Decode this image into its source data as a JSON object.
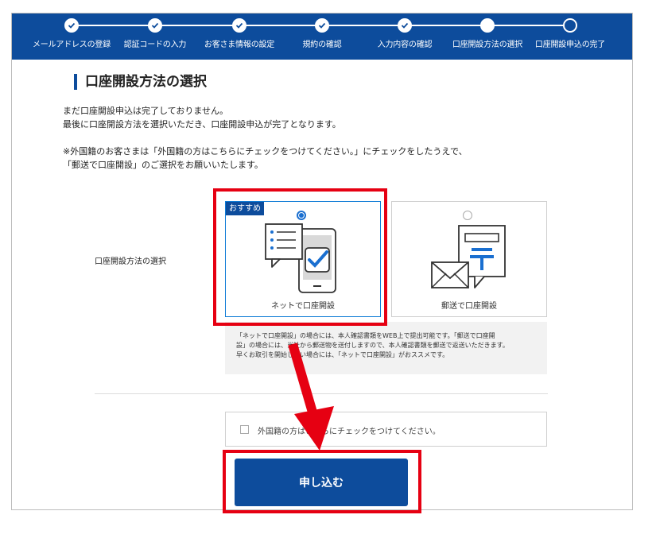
{
  "steps": [
    {
      "label": "メールアドレスの登録",
      "state": "done"
    },
    {
      "label": "認証コードの入力",
      "state": "done"
    },
    {
      "label": "お客さま情報の設定",
      "state": "done"
    },
    {
      "label": "規約の確認",
      "state": "done"
    },
    {
      "label": "入力内容の確認",
      "state": "done"
    },
    {
      "label": "口座開設方法の選択",
      "state": "current"
    },
    {
      "label": "口座開設申込の完了",
      "state": "todo"
    }
  ],
  "page": {
    "title": "口座開設方法の選択",
    "intro_line1": "まだ口座開設申込は完了しておりません。",
    "intro_line2": "最後に口座開設方法を選択いただき、口座開設申込が完了となります。",
    "foreign_line1": "※外国籍のお客さまは「外国籍の方はこちらにチェックをつけてください。」にチェックをしたうえで、",
    "foreign_line2": "「郵送で口座開設」のご選択をお願いいたします。"
  },
  "method": {
    "row_label": "口座開設方法の選択",
    "recommend_badge": "おすすめ",
    "options": [
      {
        "label": "ネットで口座開設",
        "selected": true,
        "icon": "smartphone-check-icon"
      },
      {
        "label": "郵送で口座開設",
        "selected": false,
        "icon": "mail-post-icon"
      }
    ],
    "note_line1": "「ネットで口座開設」の場合には、本人確認書類をWEB上で提出可能です。「郵送で口座開",
    "note_line2": "設」の場合には、当社から郵送物を送付しますので、本人確認書類を郵送で返送いただきます。",
    "note_line3": "早くお取引を開始したい場合には、「ネットで口座開設」がおススメです。"
  },
  "foreign_checkbox": {
    "label": "外国籍の方はこちらにチェックをつけてください。",
    "checked": false
  },
  "submit_label": "申し込む",
  "colors": {
    "brand": "#0d4c9c",
    "highlight": "#e60012",
    "selected": "#1a6fd0"
  }
}
